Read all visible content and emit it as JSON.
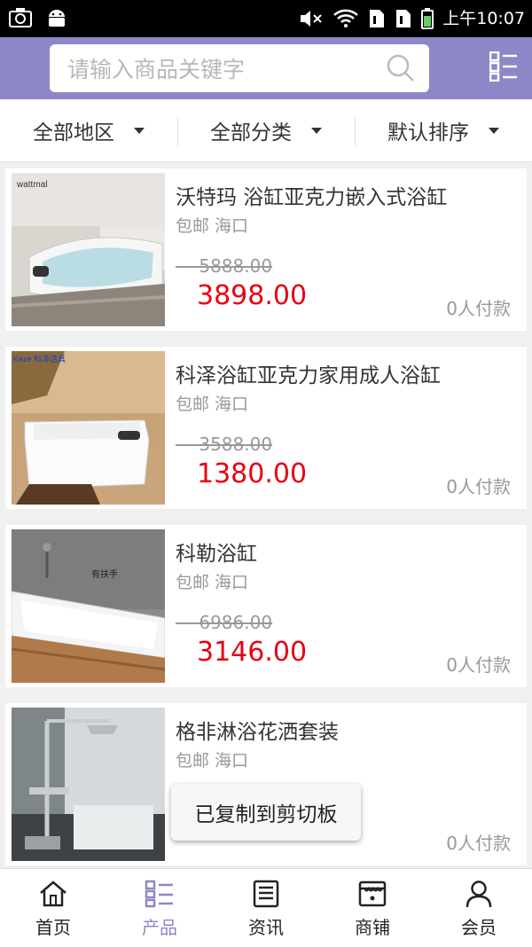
{
  "status_bar": {
    "time": "上午10:07",
    "icons": [
      "camera-icon",
      "android-icon",
      "mute-icon",
      "wifi-icon",
      "sim1-icon",
      "sim2-icon",
      "battery-icon"
    ]
  },
  "header": {
    "search_placeholder": "请输入商品关键字",
    "search_icon": "search-icon",
    "menu_icon": "list-menu-icon",
    "bg_color": "#8c88c8"
  },
  "filters": [
    {
      "label": "全部地区"
    },
    {
      "label": "全部分类"
    },
    {
      "label": "默认排序"
    }
  ],
  "products": [
    {
      "name": "沃特玛 浴缸亚克力嵌入式浴缸",
      "shipping": "包邮 海口",
      "original_price": "5888.00",
      "price": "3898.00",
      "buyers": "0人付款",
      "image_text": "wattmal"
    },
    {
      "name": "科泽浴缸亚克力家用成人浴缸",
      "shipping": "包邮 海口",
      "original_price": "3588.00",
      "price": "1380.00",
      "buyers": "0人付款",
      "image_text": "Keze 科泽洁具"
    },
    {
      "name": "科勒浴缸",
      "shipping": "包邮 海口",
      "original_price": "6986.00",
      "price": "3146.00",
      "buyers": "0人付款",
      "image_text": "有扶手"
    },
    {
      "name": "格非淋浴花洒套装",
      "shipping": "包邮 海口",
      "original_price": "",
      "price": "",
      "buyers": "0人付款",
      "image_text": ""
    }
  ],
  "toast": "已复制到剪切板",
  "tabs": [
    {
      "label": "首页",
      "icon": "home-icon"
    },
    {
      "label": "产品",
      "icon": "product-grid-icon"
    },
    {
      "label": "资讯",
      "icon": "news-icon"
    },
    {
      "label": "商铺",
      "icon": "store-icon"
    },
    {
      "label": "会员",
      "icon": "member-icon"
    }
  ],
  "active_tab": 1,
  "colors": {
    "accent": "#8c88c8",
    "price": "#e60012"
  }
}
